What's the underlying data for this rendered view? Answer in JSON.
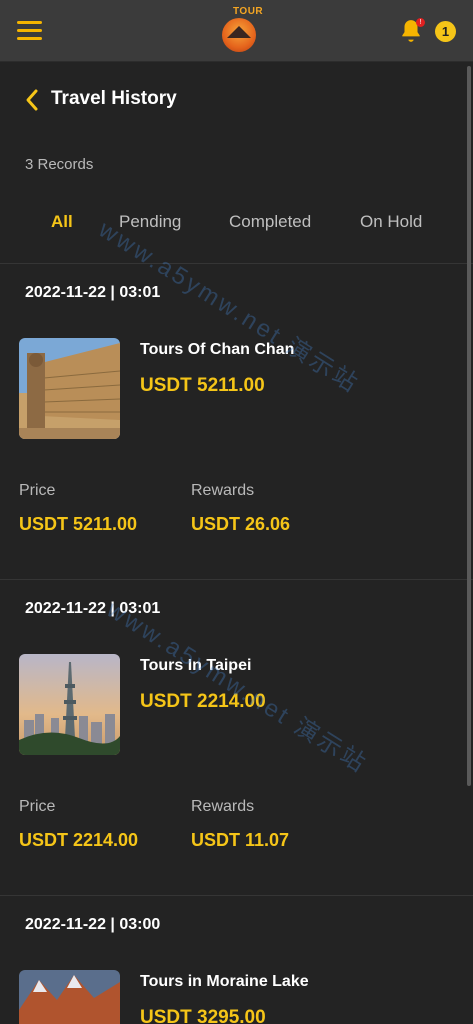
{
  "header": {
    "logo_text": "TOUR",
    "notification_badge": "!",
    "notification_count": "1"
  },
  "page": {
    "title": "Travel History",
    "records": "3 Records"
  },
  "tabs": [
    {
      "label": "All",
      "active": true
    },
    {
      "label": "Pending",
      "active": false
    },
    {
      "label": "Completed",
      "active": false
    },
    {
      "label": "On Hold",
      "active": false
    }
  ],
  "orders": [
    {
      "date": "2022-11-22 | 03:01",
      "name": "Tours Of Chan Chan",
      "amount": "USDT 5211.00",
      "price_label": "Price",
      "price": "USDT 5211.00",
      "rewards_label": "Rewards",
      "rewards": "USDT 26.06"
    },
    {
      "date": "2022-11-22 | 03:01",
      "name": "Tours In Taipei",
      "amount": "USDT 2214.00",
      "price_label": "Price",
      "price": "USDT 2214.00",
      "rewards_label": "Rewards",
      "rewards": "USDT 11.07"
    },
    {
      "date": "2022-11-22 | 03:00",
      "name": "Tours in Moraine Lake",
      "amount": "USDT 3295.00"
    }
  ],
  "watermark": "www.a5ymw.net 演示站",
  "colors": {
    "accent": "#f5c518",
    "background": "#232323",
    "topbar": "#3b3b3b"
  }
}
